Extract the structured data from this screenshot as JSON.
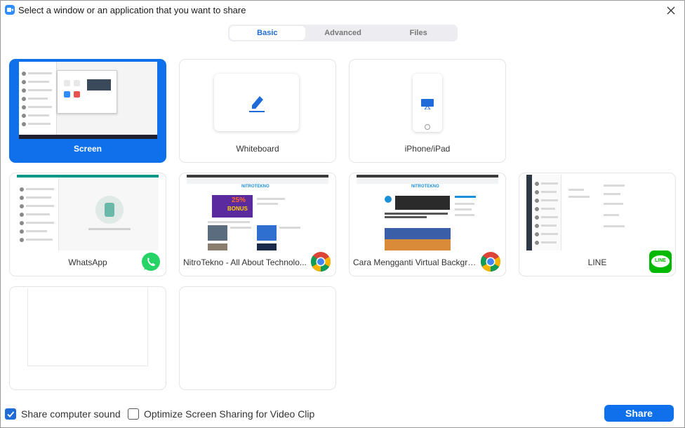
{
  "window": {
    "title": "Select a window or an application that you want to share"
  },
  "tabs": [
    {
      "label": "Basic",
      "active": true
    },
    {
      "label": "Advanced",
      "active": false
    },
    {
      "label": "Files",
      "active": false
    }
  ],
  "tiles": {
    "screen": "Screen",
    "whiteboard": "Whiteboard",
    "iphone": "iPhone/iPad",
    "whatsapp": "WhatsApp",
    "chrome1": "NitroTekno - All About Technolo...",
    "chrome2": "Cara Mengganti Virtual Backgrou...",
    "line": "LINE"
  },
  "thumbs": {
    "nitro_logo": "NITROTEKNO",
    "bonus_percent": "25%",
    "bonus": "BONUS",
    "line_badge": "LINE"
  },
  "options": {
    "share_sound": {
      "label": "Share computer sound",
      "checked": true
    },
    "optimize_video": {
      "label": "Optimize Screen Sharing for Video Clip",
      "checked": false
    }
  },
  "share_button": "Share",
  "colors": {
    "accent": "#0E71EB",
    "whatsapp": "#25D366",
    "line": "#00B900"
  }
}
